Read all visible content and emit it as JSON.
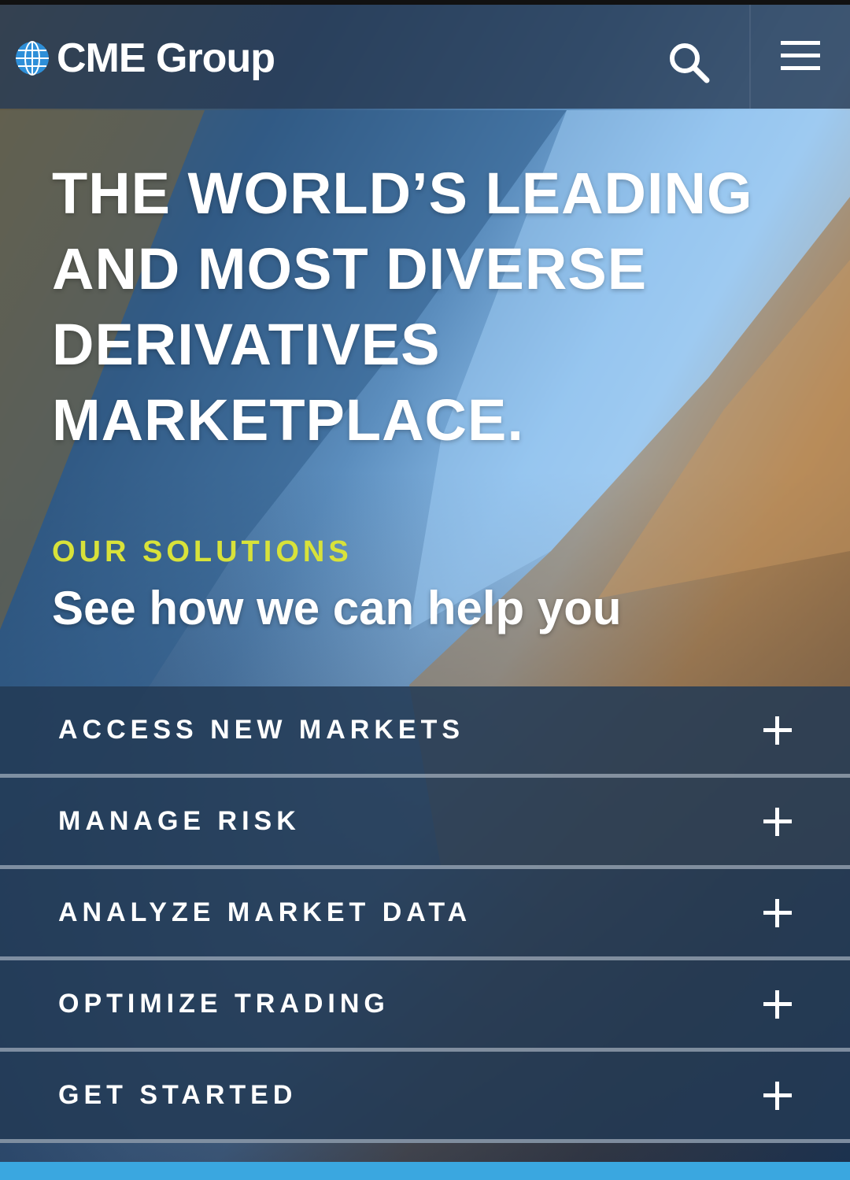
{
  "header": {
    "brand": "CME Group",
    "icons": [
      "globe-logo-icon",
      "search-icon",
      "hamburger-menu-icon"
    ]
  },
  "hero": {
    "title_lines": [
      "THE WORLD’S LEADING",
      "AND MOST DIVERSE",
      "DERIVATIVES",
      "MARKETPLACE."
    ]
  },
  "solutions": {
    "kicker": "OUR SOLUTIONS",
    "subtitle": "See how we can help you"
  },
  "accordion": {
    "items": [
      {
        "label": "ACCESS NEW MARKETS"
      },
      {
        "label": "MANAGE RISK"
      },
      {
        "label": "ANALYZE MARKET DATA"
      },
      {
        "label": "OPTIMIZE TRADING"
      },
      {
        "label": "GET STARTED"
      }
    ]
  },
  "colors": {
    "accent_yellow": "#d8e23a",
    "header_bg": "#283c55",
    "accordion_bg": "#233a55",
    "bottom_bar": "#3aa7e0"
  }
}
